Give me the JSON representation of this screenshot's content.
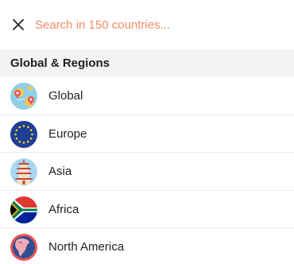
{
  "search": {
    "placeholder": "Search in 150 countries..."
  },
  "section": {
    "title": "Global & Regions"
  },
  "regions": [
    {
      "label": "Global",
      "icon": "globe-pins-icon"
    },
    {
      "label": "Europe",
      "icon": "eu-flag-icon"
    },
    {
      "label": "Asia",
      "icon": "pagoda-icon"
    },
    {
      "label": "Africa",
      "icon": "africa-flag-icon"
    },
    {
      "label": "North America",
      "icon": "north-america-globe-icon"
    }
  ],
  "colors": {
    "accent": "#f28b67",
    "section_bg": "#f3f3f3",
    "divider": "#ebebeb"
  }
}
